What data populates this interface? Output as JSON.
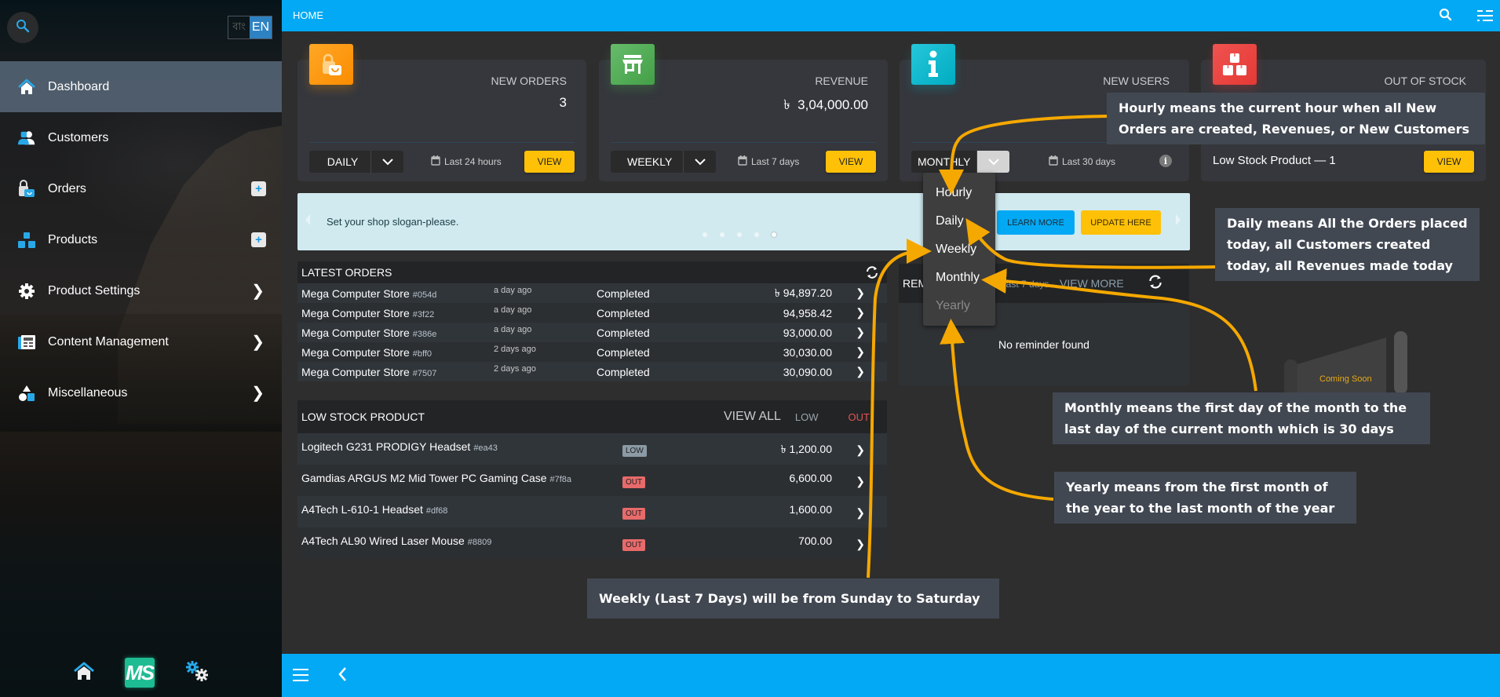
{
  "sidebar": {
    "language": {
      "bn": "বাং",
      "en": "EN",
      "active": "EN"
    },
    "items": [
      {
        "label": "Dashboard",
        "icon": "home-icon",
        "active": true
      },
      {
        "label": "Customers",
        "icon": "users-icon"
      },
      {
        "label": "Orders",
        "icon": "shopping-bag-icon",
        "action": "plus"
      },
      {
        "label": "Products",
        "icon": "boxes-icon",
        "action": "plus"
      },
      {
        "label": "Product Settings",
        "icon": "gear-icon",
        "action": "chevron"
      },
      {
        "label": "Content Management",
        "icon": "newspaper-icon",
        "action": "chevron"
      },
      {
        "label": "Miscellaneous",
        "icon": "shapes-icon",
        "action": "chevron"
      }
    ],
    "bottom": {
      "logo_text": "MS"
    }
  },
  "topbar": {
    "title": "HOME"
  },
  "cards": [
    {
      "label": "NEW ORDERS",
      "value": "3",
      "period": "DAILY",
      "range": "Last 24 hours",
      "button": "VIEW",
      "color": "#ff9800"
    },
    {
      "label": "REVENUE",
      "value": "৳  3,04,000.00",
      "period": "WEEKLY",
      "range": "Last 7 days",
      "button": "VIEW",
      "color": "#4caf50"
    },
    {
      "label": "NEW USERS",
      "value": "",
      "period": "MONTHLY",
      "range": "Last 30 days",
      "color": "#17b3c9"
    },
    {
      "label": "OUT OF STOCK",
      "value": "",
      "low_stock_text": "Low Stock Product — 1",
      "button": "VIEW",
      "color": "#e53935"
    }
  ],
  "period_dropdown": {
    "options": [
      "Hourly",
      "Daily",
      "Weekly",
      "Monthly",
      "Yearly"
    ],
    "selected": "Monthly"
  },
  "banner": {
    "slogan": "Set your shop slogan-please.",
    "dots_total": 5,
    "dots_active": 5,
    "learn_more": "LEARN MORE",
    "update_here": "UPDATE HERE"
  },
  "latest_orders": {
    "title": "LATEST ORDERS",
    "rows": [
      {
        "store": "Mega Computer Store",
        "id": "#054d",
        "ago": "a day ago",
        "status": "Completed",
        "amount": "৳ 94,897.20"
      },
      {
        "store": "Mega Computer Store",
        "id": "#3f22",
        "ago": "a day ago",
        "status": "Completed",
        "amount": "94,958.42"
      },
      {
        "store": "Mega Computer Store",
        "id": "#386e",
        "ago": "a day ago",
        "status": "Completed",
        "amount": "93,000.00"
      },
      {
        "store": "Mega Computer Store",
        "id": "#bff0",
        "ago": "2 days ago",
        "status": "Completed",
        "amount": "30,030.00"
      },
      {
        "store": "Mega Computer Store",
        "id": "#7507",
        "ago": "2 days ago",
        "status": "Completed",
        "amount": "30,090.00"
      }
    ]
  },
  "low_stock": {
    "title": "LOW STOCK PRODUCT",
    "view_all": "VIEW ALL",
    "filter_low": "LOW",
    "filter_out": "OUT",
    "rows": [
      {
        "name": "Logitech G231 PRODIGY Headset",
        "id": "#ea43",
        "badge": "LOW",
        "amount": "৳ 1,200.00"
      },
      {
        "name": "Gamdias ARGUS M2 Mid Tower PC Gaming Case",
        "id": "#7f8a",
        "badge": "OUT",
        "amount": "6,600.00"
      },
      {
        "name": "A4Tech L-610-1 Headset",
        "id": "#df68",
        "badge": "OUT",
        "amount": "1,600.00"
      },
      {
        "name": "A4Tech AL90 Wired Laser Mouse",
        "id": "#8809",
        "badge": "OUT",
        "amount": "700.00"
      }
    ]
  },
  "reminders": {
    "title": "REMINDERS",
    "range": "Last 7 days",
    "view_more": "VIEW MORE",
    "empty": "No reminder found"
  },
  "coming_soon": "Coming Soon",
  "callouts": {
    "hourly": "Hourly means the current hour when all New Orders are created, Revenues, or New Customers",
    "daily": "Daily means All the Orders placed today, all Customers created today, all Revenues made today",
    "monthly": "Monthly means the first day of the month to the last day of the current month which is 30 days",
    "yearly": "Yearly means from the first month of the year to the last month of the year",
    "weekly": "Weekly (Last 7 Days) will be from Sunday to Saturday"
  }
}
